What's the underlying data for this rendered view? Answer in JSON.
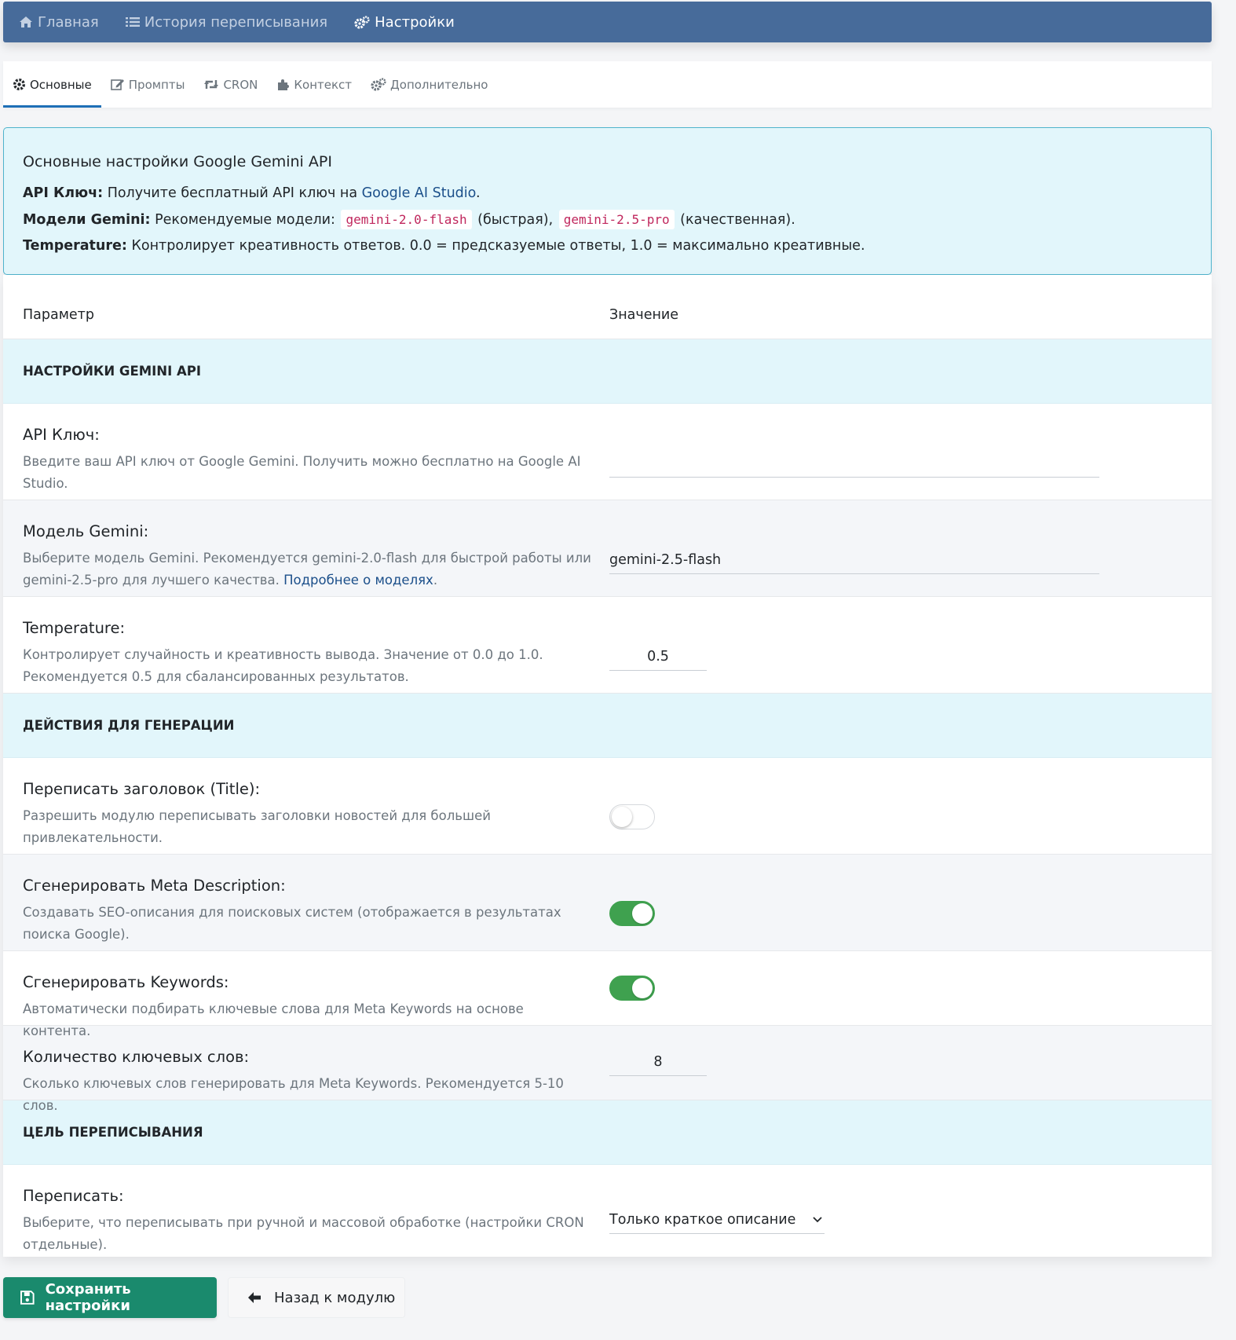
{
  "nav": {
    "items": [
      {
        "label": "Главная",
        "icon": "home-icon",
        "active": false
      },
      {
        "label": "История переписывания",
        "icon": "list-icon",
        "active": false
      },
      {
        "label": "Настройки",
        "icon": "cogs-icon",
        "active": true
      }
    ]
  },
  "tabs": [
    {
      "label": "Основные",
      "icon": "gear-icon",
      "active": true
    },
    {
      "label": "Промпты",
      "icon": "edit-icon",
      "active": false
    },
    {
      "label": "CRON",
      "icon": "retweet-icon",
      "active": false
    },
    {
      "label": "Контекст",
      "icon": "puzzle-icon",
      "active": false
    },
    {
      "label": "Дополнительно",
      "icon": "cogs-icon",
      "active": false
    }
  ],
  "info": {
    "title": "Основные настройки Google Gemini API",
    "line1_label": "API Ключ:",
    "line1_text": " Получите бесплатный API ключ на ",
    "line1_link": "Google AI Studio",
    "line1_end": ".",
    "line2_label": "Модели Gemini:",
    "line2_text": " Рекомендуемые модели: ",
    "line2_code1": "gemini-2.0-flash",
    "line2_mid": " (быстрая), ",
    "line2_code2": "gemini-2.5-pro",
    "line2_end": " (качественная).",
    "line3_label": "Temperature:",
    "line3_text": " Контролирует креативность ответов. 0.0 = предсказуемые ответы, 1.0 = максимально креативные."
  },
  "table": {
    "col_param": "Параметр",
    "col_value": "Значение"
  },
  "sections": {
    "api": "НАСТРОЙКИ GEMINI API",
    "actions": "ДЕЙСТВИЯ ДЛЯ ГЕНЕРАЦИИ",
    "target": "ЦЕЛЬ ПЕРЕПИСЫВАНИЯ"
  },
  "fields": {
    "api_key": {
      "title": "API Ключ:",
      "desc": "Введите ваш API ключ от Google Gemini. Получить можно бесплатно на Google AI Studio.",
      "value": ""
    },
    "model": {
      "title": "Модель Gemini:",
      "desc": "Выберите модель Gemini. Рекомендуется gemini-2.0-flash для быстрой работы или gemini-2.5-pro для лучшего качества. ",
      "desc_link": "Подробнее о моделях",
      "desc_end": ".",
      "value": "gemini-2.5-flash"
    },
    "temperature": {
      "title": "Temperature:",
      "desc": "Контролирует случайность и креативность вывода. Значение от 0.0 до 1.0. Рекомендуется 0.5 для сбалансированных результатов.",
      "value": "0.5"
    },
    "rewrite_title": {
      "title": "Переписать заголовок (Title):",
      "desc": "Разрешить модулю переписывать заголовки новостей для большей привлекательности.",
      "enabled": false
    },
    "meta_description": {
      "title": "Сгенерировать Meta Description:",
      "desc": "Создавать SEO-описания для поисковых систем (отображается в результатах поиска Google).",
      "enabled": true
    },
    "keywords": {
      "title": "Сгенерировать Keywords:",
      "desc": "Автоматически подбирать ключевые слова для Meta Keywords на основе контента.",
      "enabled": true
    },
    "keywords_count": {
      "title": "Количество ключевых слов:",
      "desc": "Сколько ключевых слов генерировать для Meta Keywords. Рекомендуется 5-10 слов.",
      "value": "8"
    },
    "rewrite_target": {
      "title": "Переписать:",
      "desc": "Выберите, что переписывать при ручной и массовой обработке (настройки CRON отдельные).",
      "selected": "Только краткое описание"
    }
  },
  "buttons": {
    "save": "Сохранить настройки",
    "back": "Назад к модулю"
  },
  "colors": {
    "nav_bg": "#476b9a",
    "info_bg": "#e2f6fb",
    "toggle_on": "#3fa14f",
    "save_btn": "#1a8a6d",
    "link": "#1b4f8a",
    "code": "#c0275d"
  }
}
